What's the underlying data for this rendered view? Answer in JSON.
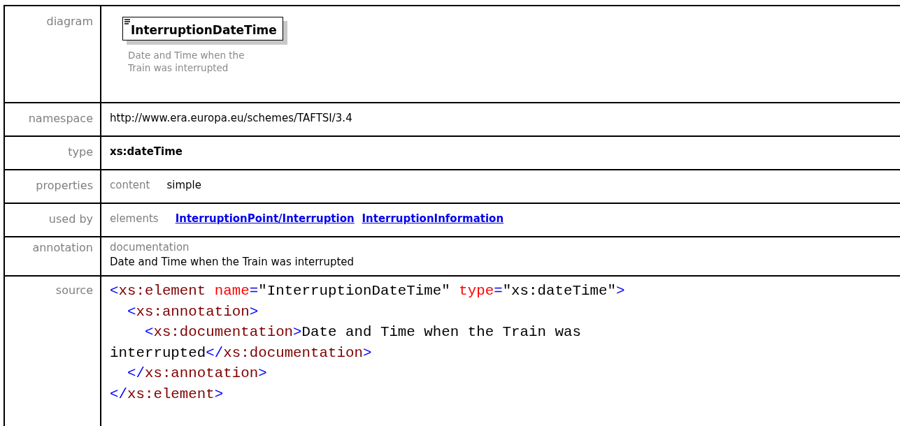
{
  "diagram": {
    "label": "diagram",
    "element_name": "InterruptionDateTime",
    "annotation": [
      "Date and Time when the",
      "Train was interrupted"
    ]
  },
  "rows": [
    {
      "label": "namespace",
      "kind": "text",
      "value": "http://www.era.europa.eu/schemes/TAFTSI/3.4"
    },
    {
      "label": "type",
      "kind": "bold",
      "value": "xs:dateTime"
    },
    {
      "label": "properties",
      "kind": "pairs",
      "key": "content",
      "value": "simple"
    },
    {
      "label": "used by",
      "kind": "links",
      "key": "elements",
      "links": [
        "InterruptionPoint/Interruption",
        "InterruptionInformation"
      ]
    },
    {
      "label": "annotation",
      "kind": "doc",
      "key": "documentation",
      "value": "Date and Time when the Train was interrupted"
    }
  ],
  "source": {
    "label": "source",
    "lines": [
      [
        {
          "kind": "punct",
          "s": "<"
        },
        {
          "kind": "tag",
          "s": "xs:element"
        },
        {
          "kind": "attr",
          "s": " name"
        },
        {
          "kind": "punct",
          "s": "="
        },
        {
          "kind": "text",
          "s": "\"InterruptionDateTime\" "
        },
        {
          "kind": "attr",
          "s": "type"
        },
        {
          "kind": "punct",
          "s": "="
        },
        {
          "kind": "text",
          "s": "\"xs:dateTime\""
        },
        {
          "kind": "punct",
          "s": ">"
        }
      ],
      [
        {
          "kind": "punct",
          "s": "  <"
        },
        {
          "kind": "tag",
          "s": "xs:annotation"
        },
        {
          "kind": "punct",
          "s": ">"
        }
      ],
      [
        {
          "kind": "punct",
          "s": "    <"
        },
        {
          "kind": "tag",
          "s": "xs:documentation"
        },
        {
          "kind": "punct",
          "s": ">"
        },
        {
          "kind": "text",
          "s": "Date and Time when the Train was"
        }
      ],
      [
        {
          "kind": "text",
          "s": "interrupted"
        },
        {
          "kind": "punct",
          "s": "</"
        },
        {
          "kind": "tag",
          "s": "xs:documentation"
        },
        {
          "kind": "punct",
          "s": ">"
        }
      ],
      [
        {
          "kind": "punct",
          "s": "  </"
        },
        {
          "kind": "tag",
          "s": "xs:annotation"
        },
        {
          "kind": "punct",
          "s": ">"
        }
      ],
      [
        {
          "kind": "punct",
          "s": "</"
        },
        {
          "kind": "tag",
          "s": "xs:element"
        },
        {
          "kind": "punct",
          "s": ">"
        }
      ]
    ]
  }
}
